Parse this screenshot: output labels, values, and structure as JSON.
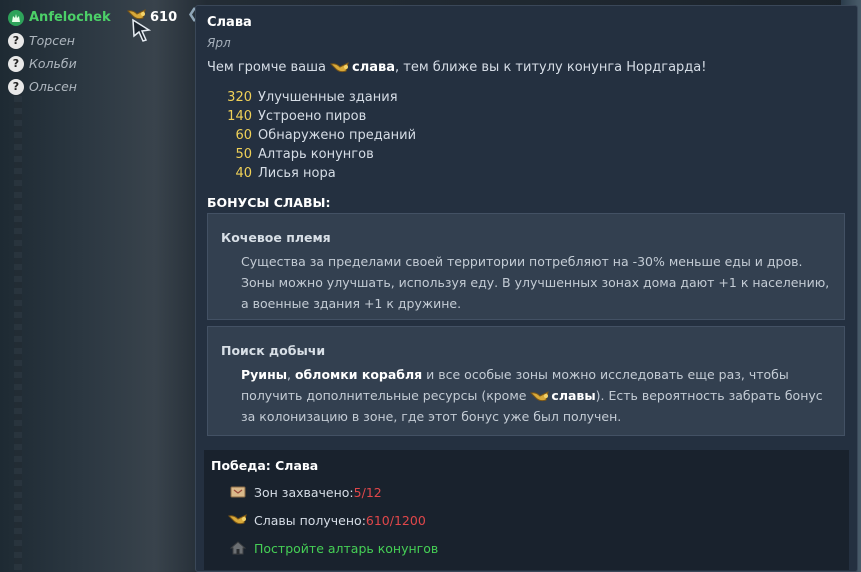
{
  "players": [
    {
      "name": "Anfelochek",
      "kind": "self",
      "icon": "wolf-clan-icon"
    },
    {
      "name": "Торсен",
      "kind": "unknown",
      "icon": "question-icon"
    },
    {
      "name": "Кольби",
      "kind": "unknown",
      "icon": "question-icon"
    },
    {
      "name": "Ольсен",
      "kind": "unknown",
      "icon": "question-icon"
    }
  ],
  "top_fame": {
    "value": "610",
    "icon": "fame-horn-icon"
  },
  "tooltip": {
    "title": "Слава",
    "subtitle": "Ярл",
    "intro_before": "Чем громче ваша ",
    "intro_bold": "слава",
    "intro_after": ", тем ближе вы к титулу конунга Нордгарда!",
    "sources": [
      {
        "value": "320",
        "label": "Улучшенные здания"
      },
      {
        "value": "140",
        "label": "Устроено пиров"
      },
      {
        "value": "60",
        "label": "Обнаружено преданий"
      },
      {
        "value": "50",
        "label": "Алтарь конунгов"
      },
      {
        "value": "40",
        "label": "Лисья нора"
      }
    ],
    "bonuses_heading": "БОНУСЫ СЛАВЫ:",
    "bonus1": {
      "name": "Кочевое племя",
      "desc": "Существа за пределами своей территории потребляют на -30% меньше еды и дров. Зоны можно улучшать, используя еду. В улучшенных зонах дома дают +1 к населению, а военные здания +1 к дружине."
    },
    "bonus2": {
      "name": "Поиск добычи",
      "b1": "Руины",
      "sep": ", ",
      "b2": "обломки корабля",
      "t1": " и все особые зоны можно исследовать еще раз, чтобы получить дополнительные ресурсы (кроме ",
      "b3": "славы",
      "t2": "). Есть вероятность забрать бонус за колонизацию в зоне, где этот бонус уже был получен."
    },
    "victory": {
      "title": "Победа: Слава",
      "zones_label": "Зон захвачено: ",
      "zones_value": "5/12",
      "fame_label": "Славы получено: ",
      "fame_value": "610/1200",
      "altar_text": "Постройте алтарь конунгов"
    }
  },
  "colors": {
    "panel_bg": "#243040",
    "accent_yellow": "#f0d158",
    "accent_red": "#e0474a",
    "accent_green": "#45cf55",
    "player_green": "#4cd068"
  }
}
